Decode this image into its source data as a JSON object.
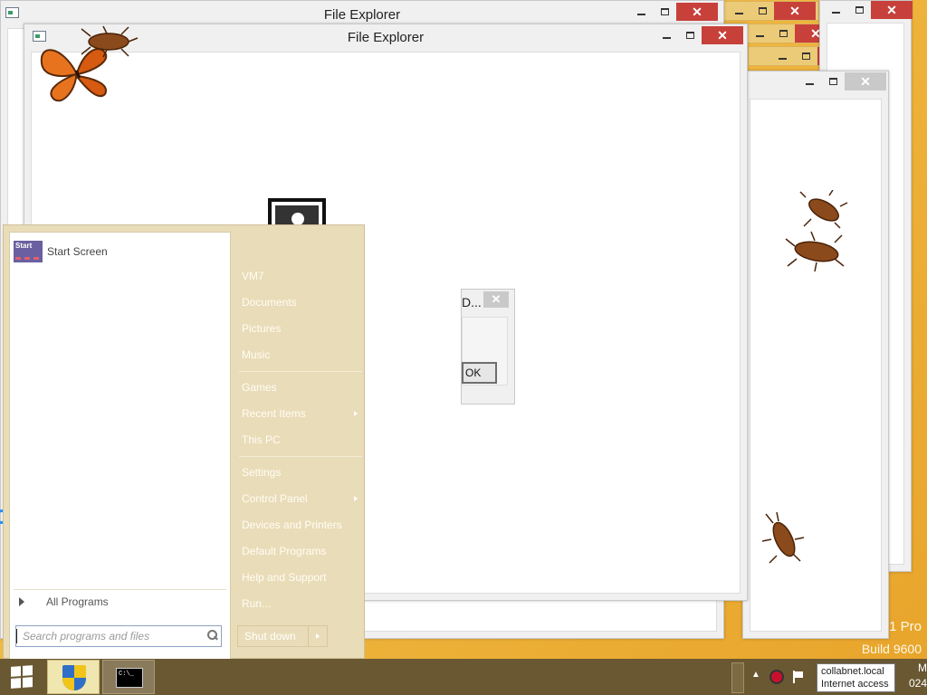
{
  "desktop": {
    "watermark_edition": "1 Pro",
    "watermark_build": "Build 9600"
  },
  "windows": {
    "back": {
      "title": "File Explorer"
    },
    "front": {
      "title": "File Explorer"
    },
    "controls": {
      "minimize": "—",
      "maximize": "□",
      "close": "✕"
    }
  },
  "dialog": {
    "title_fragment": "D...",
    "ok_fragment": "OK",
    "close": "✕"
  },
  "start_menu": {
    "pinned": {
      "tile_text": "Start",
      "label": "Start Screen"
    },
    "all_programs": "All Programs",
    "search_placeholder": "Search programs and files",
    "right_items": [
      {
        "label": "VM7"
      },
      {
        "label": "Documents"
      },
      {
        "label": "Pictures"
      },
      {
        "label": "Music"
      },
      {
        "label": "Games"
      },
      {
        "label": "Recent Items"
      },
      {
        "label": "This PC"
      },
      {
        "label": "Settings"
      },
      {
        "label": "Control Panel"
      },
      {
        "label": "Devices and Printers"
      },
      {
        "label": "Default Programs"
      },
      {
        "label": "Help and Support"
      },
      {
        "label": "Run..."
      }
    ],
    "shutdown_label": "Shut down"
  },
  "taskbar": {
    "cmd_text": "C:\\_",
    "tooltip_line1": "collabnet.local",
    "tooltip_line2": "Internet access",
    "clock_time": "M",
    "clock_date": "024"
  },
  "colors": {
    "accent_close": "#c7403a",
    "start_menu_bg": "#e9dcb8",
    "taskbar_bg": "#6a5832",
    "desktop_bg": "#f0b941"
  }
}
